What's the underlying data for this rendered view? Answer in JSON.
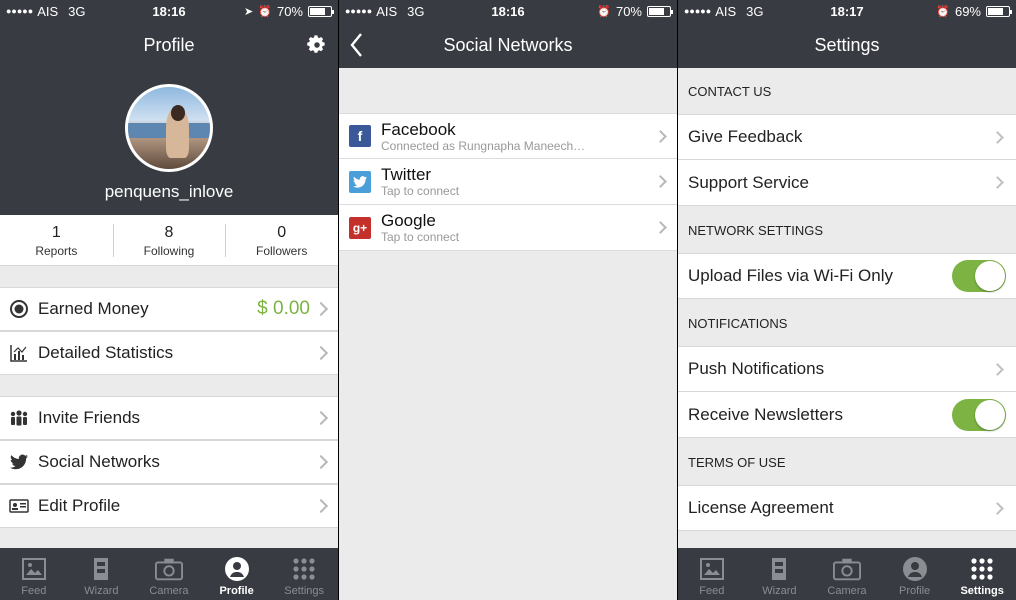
{
  "screens": {
    "profile": {
      "status": {
        "carrier": "AIS",
        "network": "3G",
        "time": "18:16",
        "battery": "70%",
        "battery_level": 0.7
      },
      "title": "Profile",
      "username": "penquens_inlove",
      "stats": [
        {
          "value": "1",
          "label": "Reports"
        },
        {
          "value": "8",
          "label": "Following"
        },
        {
          "value": "0",
          "label": "Followers"
        }
      ],
      "rows": {
        "earned_money": {
          "label": "Earned Money",
          "value": "$ 0.00"
        },
        "detailed_statistics": {
          "label": "Detailed Statistics"
        },
        "invite_friends": {
          "label": "Invite Friends"
        },
        "social_networks": {
          "label": "Social Networks"
        },
        "edit_profile": {
          "label": "Edit Profile"
        }
      },
      "tabs": [
        {
          "label": "Feed",
          "icon": "image-icon"
        },
        {
          "label": "Wizard",
          "icon": "wizard-icon"
        },
        {
          "label": "Camera",
          "icon": "camera-icon"
        },
        {
          "label": "Profile",
          "icon": "profile-icon"
        },
        {
          "label": "Settings",
          "icon": "grid-icon"
        }
      ],
      "active_tab": "Profile"
    },
    "social": {
      "status": {
        "carrier": "AIS",
        "network": "3G",
        "time": "18:16",
        "battery": "70%",
        "battery_level": 0.7
      },
      "title": "Social Networks",
      "networks": [
        {
          "name": "Facebook",
          "sub": "Connected as Rungnapha Maneech…",
          "color": "#3b5998"
        },
        {
          "name": "Twitter",
          "sub": "Tap to connect",
          "color": "#4a9fd8"
        },
        {
          "name": "Google",
          "sub": "Tap to connect",
          "color": "#c4302b"
        }
      ]
    },
    "settings": {
      "status": {
        "carrier": "AIS",
        "network": "3G",
        "time": "18:17",
        "battery": "69%",
        "battery_level": 0.69
      },
      "title": "Settings",
      "sections": {
        "contact_us": "CONTACT US",
        "network_settings": "NETWORK SETTINGS",
        "notifications": "NOTIFICATIONS",
        "terms_of_use": "TERMS OF USE"
      },
      "rows": {
        "give_feedback": "Give Feedback",
        "support_service": "Support Service",
        "upload_wifi": "Upload Files via Wi-Fi Only",
        "push_notifications": "Push Notifications",
        "receive_newsletters": "Receive Newsletters",
        "license_agreement": "License Agreement"
      },
      "toggles": {
        "upload_wifi": true,
        "receive_newsletters": true
      },
      "active_tab": "Settings"
    }
  },
  "colors": {
    "bar": "#383b41",
    "accent_green": "#7cb342",
    "background": "#ebebeb"
  }
}
